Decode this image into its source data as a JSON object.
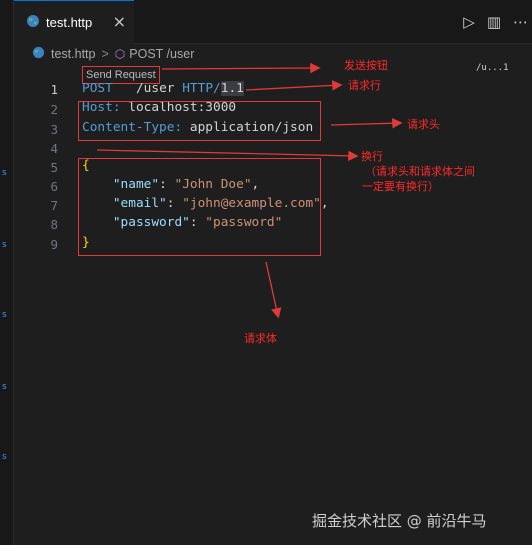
{
  "tab": {
    "file_name": "test.http",
    "close_glyph": "×",
    "file_icon": "globe-icon"
  },
  "actions": {
    "run_icon": "▷",
    "split_icon": "▥",
    "more_icon": "⋯"
  },
  "breadcrumb": {
    "file": "test.http",
    "separator": ">",
    "symbol": "POST /user"
  },
  "minimap_label": "/u...1",
  "codelens": "Send Request",
  "gutter": [
    "1",
    "2",
    "3",
    "4",
    "5",
    "6",
    "7",
    "8",
    "9"
  ],
  "code": {
    "line1": {
      "method": "POST",
      "path": "/user",
      "proto": "HTTP/",
      "version": "1.1"
    },
    "line2": {
      "name": "Host:",
      "value": "localhost:3000"
    },
    "line3": {
      "name": "Content-Type:",
      "value": "application/json"
    },
    "line5": "{",
    "line6": {
      "key": "\"name\"",
      "colon": ": ",
      "value": "\"John Doe\"",
      "comma": ","
    },
    "line7": {
      "key": "\"email\"",
      "colon": ": ",
      "value": "\"john@example.com\"",
      "comma": ","
    },
    "line8": {
      "key": "\"password\"",
      "colon": ": ",
      "value": "\"password\""
    },
    "line9": "}"
  },
  "annotations": {
    "send_button": "发送按钮",
    "request_line": "请求行",
    "request_header": "请求头",
    "newline": "换行",
    "newline_note_1": "（请求头和请求体之间",
    "newline_note_2": "一定要有换行）",
    "request_body": "请求体"
  },
  "watermark": "掘金技术社区 @ 前沿牛马",
  "colors": {
    "annotation": "#e03a3a",
    "accent": "#0078d4",
    "background": "#1e1e1e"
  }
}
